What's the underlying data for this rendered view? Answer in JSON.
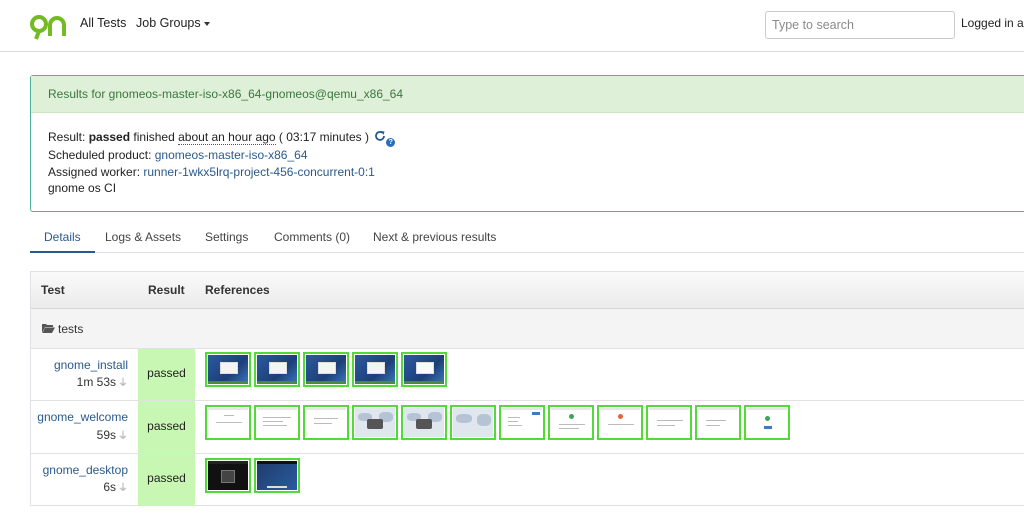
{
  "navbar": {
    "logo_name": "openqa-logo",
    "all_tests": "All Tests",
    "job_groups": "Job Groups",
    "search_placeholder": "Type to search",
    "logged_in": "Logged in as"
  },
  "result": {
    "header": "Results for gnomeos-master-iso-x86_64-gnomeos@qemu_x86_64",
    "result_label": "Result:",
    "result_value": "passed",
    "finished_text": "finished",
    "finished_when": "about an hour ago",
    "duration_open": "(",
    "duration": "03:17 minutes",
    "duration_close": ")",
    "scheduled_label": "Scheduled product:",
    "scheduled_product": "gnomeos-master-iso-x86_64",
    "worker_label": "Assigned worker:",
    "worker": "runner-1wkx5lrq-project-456-concurrent-0:1",
    "comment": "gnome os CI"
  },
  "tabs": [
    {
      "label": "Details",
      "active": true
    },
    {
      "label": "Logs & Assets",
      "active": false
    },
    {
      "label": "Settings",
      "active": false
    },
    {
      "label": "Comments (0)",
      "active": false
    },
    {
      "label": "Next & previous results",
      "active": false
    }
  ],
  "table": {
    "headers": [
      "Test",
      "Result",
      "References"
    ],
    "group": "tests",
    "rows": [
      {
        "name": "gnome_install",
        "duration": "1m 53s",
        "result": "passed",
        "thumbs": [
          "blue",
          "blue",
          "blue",
          "blue",
          "blue"
        ]
      },
      {
        "name": "gnome_welcome",
        "duration": "59s",
        "result": "passed",
        "thumbs": [
          "white",
          "white",
          "white",
          "map",
          "map",
          "map",
          "white",
          "white",
          "white",
          "white",
          "white",
          "white"
        ]
      },
      {
        "name": "gnome_desktop",
        "duration": "6s",
        "result": "passed",
        "thumbs": [
          "dark",
          "dark2"
        ]
      }
    ]
  },
  "colors": {
    "accent": "#2a5a8c",
    "header_green": "#dff0d8",
    "passed_bg": "#c8f7b3",
    "thumb_border": "#52d93a",
    "logo_green": "#73ba25"
  }
}
